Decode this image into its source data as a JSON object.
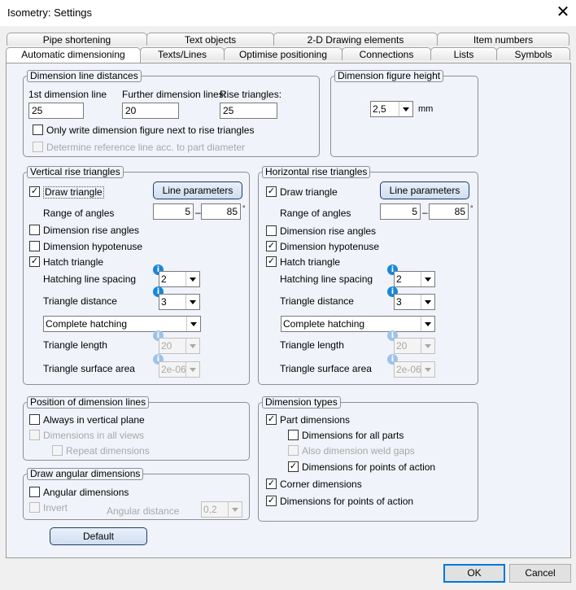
{
  "window": {
    "title": "Isometry: Settings",
    "close_symbol": "✕"
  },
  "tabs": {
    "back": [
      "Pipe shortening",
      "Text objects",
      "2-D Drawing elements",
      "Item numbers"
    ],
    "front": [
      "Automatic dimensioning",
      "Texts/Lines",
      "Optimise positioning",
      "Connections",
      "Lists",
      "Symbols"
    ]
  },
  "dim_line_distances": {
    "title": "Dimension line distances",
    "first_label": "1st dimension line",
    "first_value": "25",
    "further_label": "Further dimension lines:",
    "further_value": "20",
    "rise_label": "Rise triangles:",
    "rise_value": "25",
    "only_write": "Only write dimension figure next to rise triangles",
    "determine_ref": "Determine reference line acc. to part diameter"
  },
  "dim_figure_height": {
    "title": "Dimension figure height",
    "value": "2,5",
    "unit": "mm"
  },
  "vertical": {
    "title": "Vertical rise triangles",
    "draw_triangle": "Draw triangle",
    "line_params": "Line parameters",
    "range": "Range of angles",
    "range_from": "5",
    "range_dash": "–",
    "range_to": "85",
    "degree": "°",
    "dim_rise": "Dimension rise angles",
    "dim_hyp": "Dimension hypotenuse",
    "hatch": "Hatch triangle",
    "hatch_spacing": "Hatching line spacing",
    "hatch_spacing_value": "2",
    "tri_distance": "Triangle distance",
    "tri_distance_value": "3",
    "hatching_mode": "Complete hatching",
    "tri_length": "Triangle length",
    "tri_length_value": "20",
    "tri_area": "Triangle surface area",
    "tri_area_value": "2e-06"
  },
  "horizontal": {
    "title": "Horizontal rise triangles",
    "draw_triangle": "Draw triangle",
    "line_params": "Line parameters",
    "range": "Range of angles",
    "range_from": "5",
    "range_dash": "–",
    "range_to": "85",
    "degree": "°",
    "dim_rise": "Dimension rise angles",
    "dim_hyp": "Dimension hypotenuse",
    "hatch": "Hatch triangle",
    "hatch_spacing": "Hatching line spacing",
    "hatch_spacing_value": "2",
    "tri_distance": "Triangle distance",
    "tri_distance_value": "3",
    "hatching_mode": "Complete hatching",
    "tri_length": "Triangle length",
    "tri_length_value": "20",
    "tri_area": "Triangle surface area",
    "tri_area_value": "2e-06"
  },
  "position": {
    "title": "Position of dimension lines",
    "vertical_plane": "Always in vertical plane",
    "all_views": "Dimensions in all views",
    "repeat": "Repeat dimensions"
  },
  "angular": {
    "title": "Draw angular dimensions",
    "angular_dims": "Angular dimensions",
    "invert": "Invert",
    "distance_label": "Angular distance",
    "distance_value": "0,2"
  },
  "dim_types": {
    "title": "Dimension types",
    "part_dims": "Part dimensions",
    "all_parts": "Dimensions for all parts",
    "weld_gaps": "Also dimension weld gaps",
    "points_action_sub": "Dimensions for points of action",
    "corner": "Corner dimensions",
    "points_action": "Dimensions for points of action"
  },
  "buttons": {
    "default": "Default",
    "ok": "OK",
    "cancel": "Cancel"
  },
  "info_glyph": "i",
  "check_glyph": "✓"
}
